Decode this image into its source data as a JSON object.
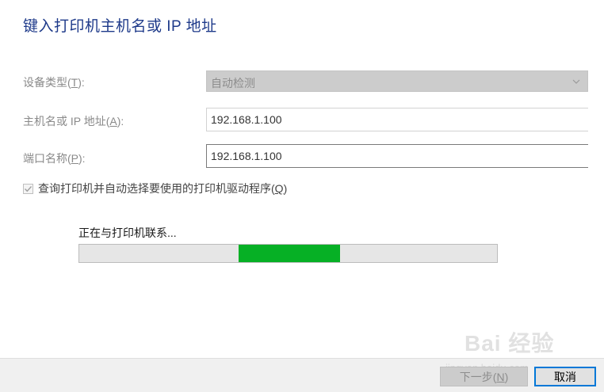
{
  "dialog": {
    "title": "键入打印机主机名或 IP 地址"
  },
  "form": {
    "device_type": {
      "label_prefix": "设备类型(",
      "accel": "T",
      "label_suffix": "):",
      "value": "自动检测"
    },
    "host": {
      "label_prefix": "主机名或 IP 地址(",
      "accel": "A",
      "label_suffix": "):",
      "value": "192.168.1.100"
    },
    "port": {
      "label_prefix": "端口名称(",
      "accel": "P",
      "label_suffix": "):",
      "value": "192.168.1.100"
    },
    "query_driver": {
      "label_prefix": "查询打印机并自动选择要使用的打印机驱动程序(",
      "accel": "Q",
      "label_suffix": ")",
      "checked": true
    }
  },
  "progress": {
    "status_text": "正在与打印机联系...",
    "marquee_start": 0.382,
    "marquee_end": 0.625,
    "color": "#06b025"
  },
  "footer": {
    "next_prefix": "下一步(",
    "next_accel": "N",
    "next_suffix": ")",
    "cancel_label": "取消"
  },
  "watermark": {
    "logo_text": "Bai 经验",
    "url_text": "jingyan.baidu.com"
  },
  "icons": {
    "dropdown": "chevron-down-icon",
    "check": "check-icon"
  }
}
